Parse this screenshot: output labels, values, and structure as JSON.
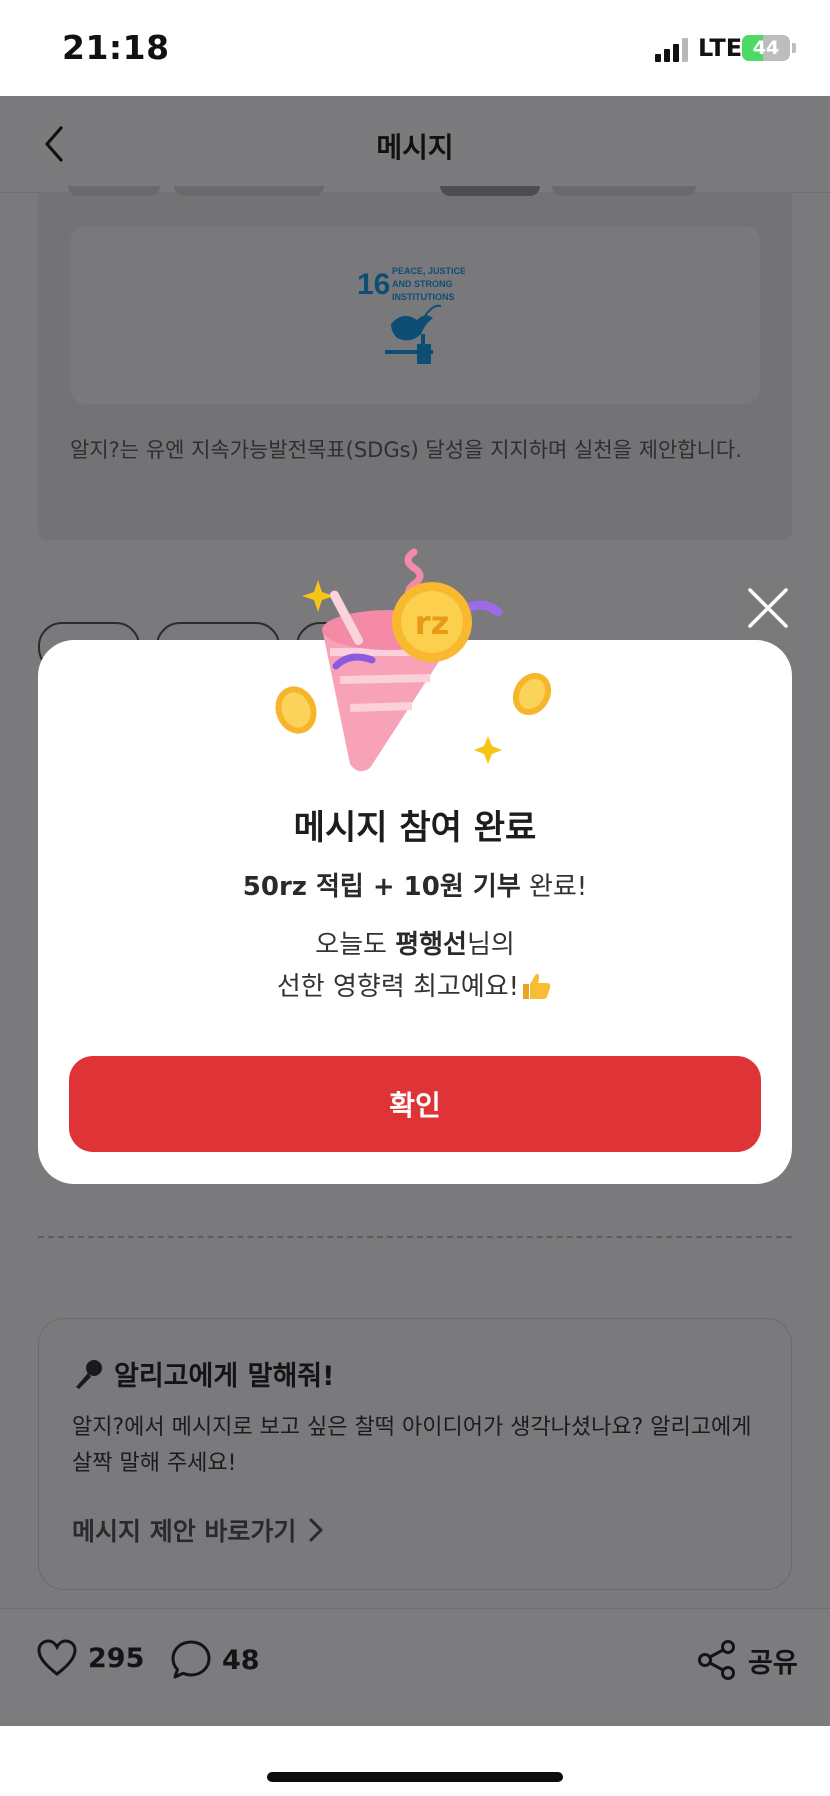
{
  "status_bar": {
    "time": "21:18",
    "network": "LTE",
    "battery": "44",
    "battery_level": 0.44
  },
  "header": {
    "title": "메시지"
  },
  "sdg": {
    "number": "16",
    "label_lines": [
      "PEACE, JUSTICE",
      "AND STRONG",
      "INSTITUTIONS"
    ],
    "description": "알지?는 유엔 지속가능발전목표(SDGs) 달성을 지지하며 실천을 제안합니다."
  },
  "modal": {
    "title": "메시지 참여 완료",
    "reward_bold": "50rz 적립 + 10원 기부",
    "reward_rest": " 완료!",
    "msg_prefix": "오늘도 ",
    "user_name": "평행선",
    "msg_suffix": "님의",
    "msg_line2": "선한 영향력 최고예요!",
    "coin_label": "rz",
    "confirm_label": "확인"
  },
  "suggest": {
    "title": "알리고에게 말해줘!",
    "body": "알지?에서 메시지로 보고 싶은 찰떡 아이디어가 생각나셨나요? 알리고에게 살짝 말해 주세요!",
    "link": "메시지 제안 바로가기"
  },
  "actions": {
    "likes": "295",
    "comments": "48",
    "share": "공유"
  },
  "colors": {
    "accent": "#df3437",
    "overlay": "#7a7a7c",
    "battery": "#4cd964"
  }
}
